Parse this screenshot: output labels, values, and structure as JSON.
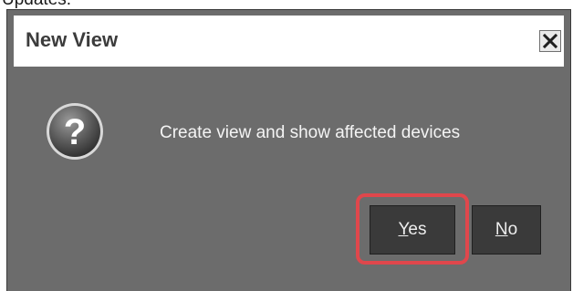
{
  "background_fragment": {
    "text": "Updates."
  },
  "dialog": {
    "title": "New View",
    "message": "Create view and show affected devices",
    "icon": "question-icon",
    "close_icon": "close-icon",
    "buttons": {
      "yes": {
        "mnemonic": "Y",
        "rest": "es"
      },
      "no": {
        "mnemonic": "N",
        "rest": "o"
      }
    }
  },
  "colors": {
    "dialog_body": "#6c6c6c",
    "title_bar": "#ffffff",
    "button_bg": "#3a3a3a",
    "highlight": "#e0474c"
  }
}
